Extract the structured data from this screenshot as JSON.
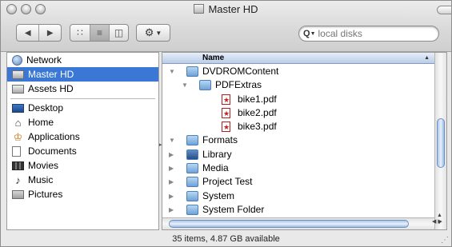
{
  "window": {
    "title": "Master HD",
    "status": "35 items, 4.87 GB available"
  },
  "toolbar": {
    "back_icon": "back-arrow-icon",
    "forward_icon": "forward-arrow-icon",
    "views": [
      "icon-view",
      "list-view",
      "column-view"
    ],
    "selected_view": "list-view",
    "action_icon": "gear-icon"
  },
  "search": {
    "placeholder": "local disks"
  },
  "sidebar": {
    "devices": [
      {
        "label": "Network",
        "icon": "globe-icon"
      },
      {
        "label": "Master HD",
        "icon": "hard-disk-icon",
        "selected": true
      },
      {
        "label": "Assets HD",
        "icon": "hard-disk-icon"
      }
    ],
    "places": [
      {
        "label": "Desktop",
        "icon": "desktop-icon"
      },
      {
        "label": "Home",
        "icon": "home-icon"
      },
      {
        "label": "Applications",
        "icon": "applications-icon"
      },
      {
        "label": "Documents",
        "icon": "documents-icon"
      },
      {
        "label": "Movies",
        "icon": "movies-icon"
      },
      {
        "label": "Music",
        "icon": "music-icon"
      },
      {
        "label": "Pictures",
        "icon": "pictures-icon"
      }
    ]
  },
  "list": {
    "column_header": "Name",
    "rows": [
      {
        "name": "DVDROMContent",
        "kind": "folder",
        "level": 0,
        "expanded": true
      },
      {
        "name": "PDFExtras",
        "kind": "folder",
        "level": 1,
        "expanded": true
      },
      {
        "name": "bike1.pdf",
        "kind": "pdf",
        "level": 2
      },
      {
        "name": "bike2.pdf",
        "kind": "pdf",
        "level": 2
      },
      {
        "name": "bike3.pdf",
        "kind": "pdf",
        "level": 2
      },
      {
        "name": "Formats",
        "kind": "folder",
        "level": 0,
        "expanded": true
      },
      {
        "name": "Library",
        "kind": "folder-app",
        "level": 0,
        "expanded": false
      },
      {
        "name": "Media",
        "kind": "folder",
        "level": 0,
        "expanded": false
      },
      {
        "name": "Project Test",
        "kind": "folder",
        "level": 0,
        "expanded": false
      },
      {
        "name": "System",
        "kind": "folder",
        "level": 0,
        "expanded": false
      },
      {
        "name": "System Folder",
        "kind": "folder",
        "level": 0,
        "expanded": false
      }
    ]
  }
}
